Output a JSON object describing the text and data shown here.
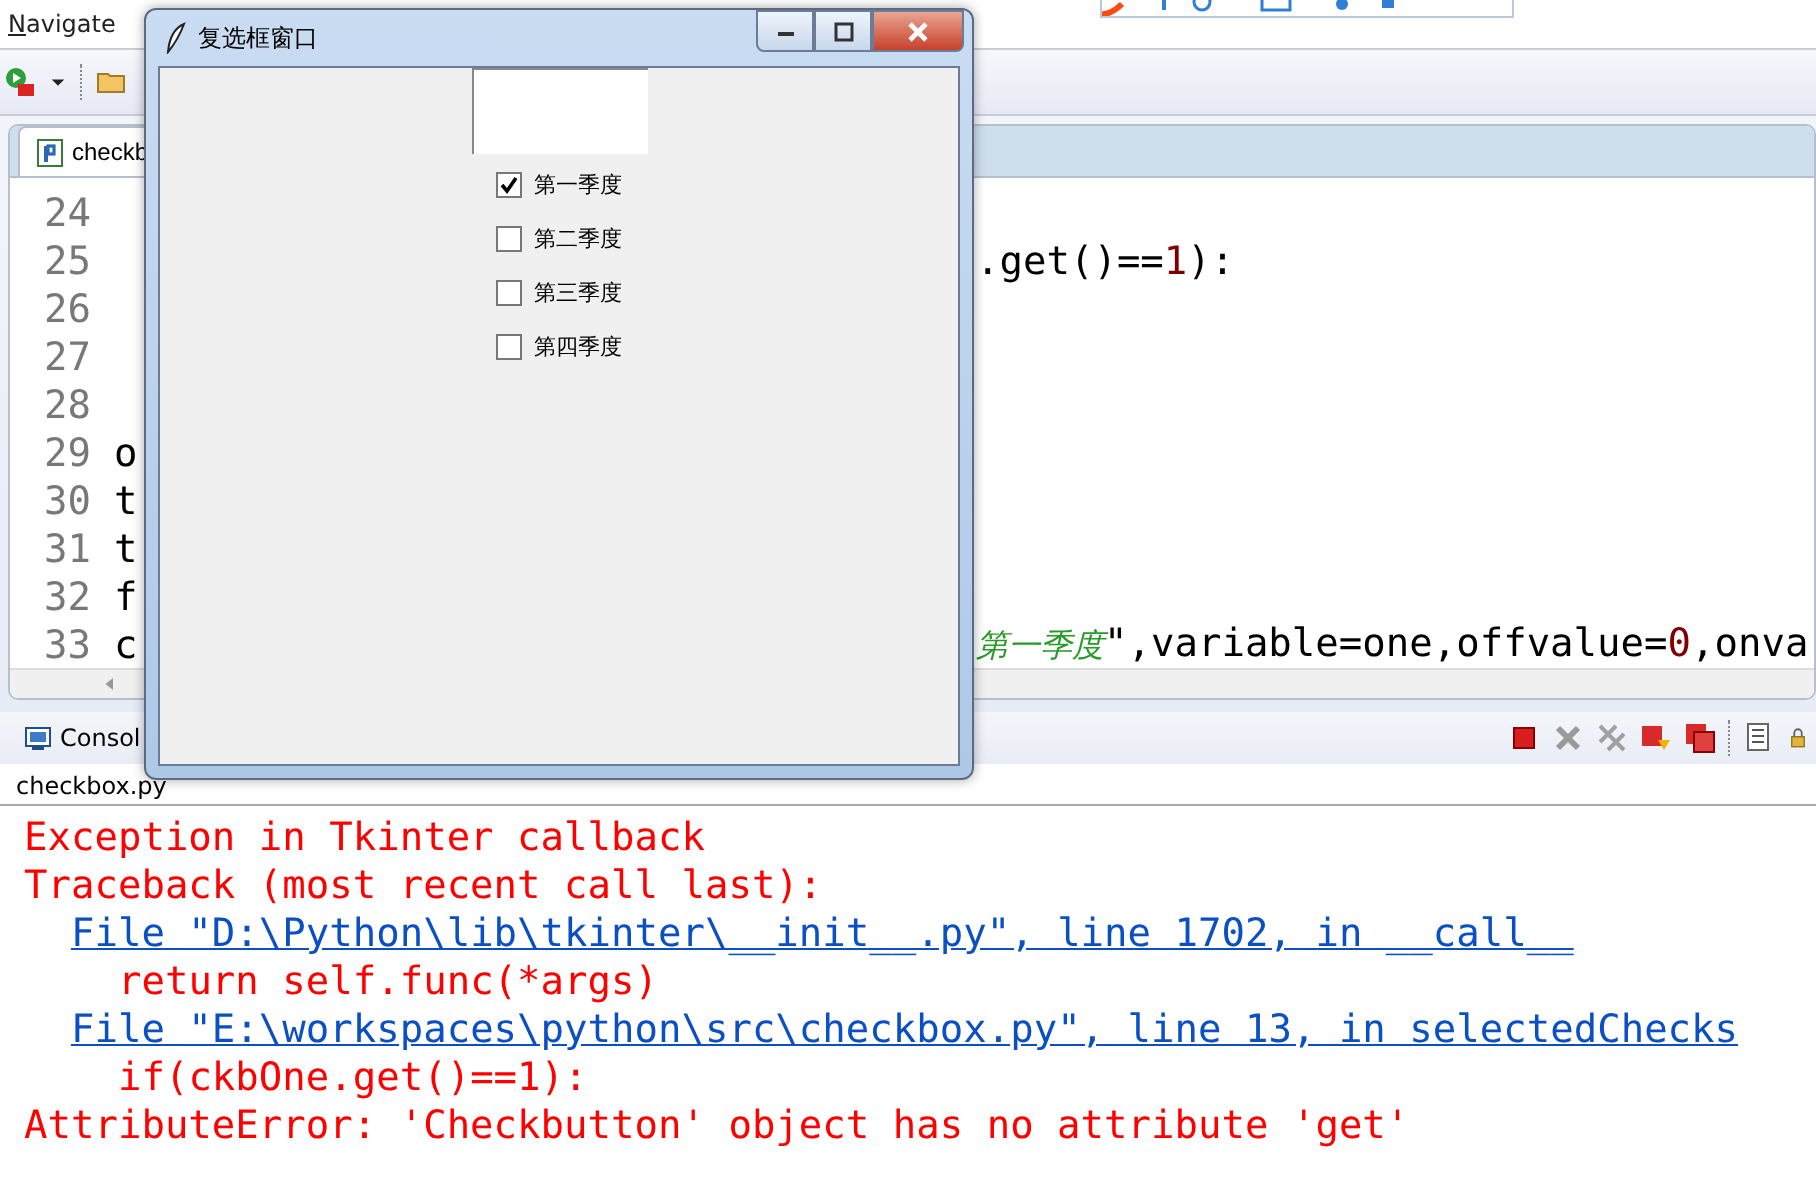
{
  "menu": [
    {
      "label": "Navigate"
    }
  ],
  "editor": {
    "tab": {
      "label": "checkb",
      "selected": true
    },
    "lines": [
      {
        "number": "24"
      },
      {
        "number": "25",
        "right": [
          {
            "text": ".get()==",
            "kind": "plain"
          },
          {
            "text": "1",
            "kind": "number"
          },
          {
            "text": "):",
            "kind": "plain"
          }
        ]
      },
      {
        "number": "26"
      },
      {
        "number": "27"
      },
      {
        "number": "28"
      },
      {
        "number": "29",
        "left": "o"
      },
      {
        "number": "30",
        "left": "t"
      },
      {
        "number": "31",
        "left": "t"
      },
      {
        "number": "32",
        "left": "f"
      },
      {
        "number": "33",
        "left": "c",
        "right": [
          {
            "text": "第一季度",
            "kind": "string"
          },
          {
            "text": "\",variable=one,offvalue=",
            "kind": "plain"
          },
          {
            "text": "0",
            "kind": "number"
          },
          {
            "text": ",onva",
            "kind": "plain"
          }
        ]
      }
    ]
  },
  "console": {
    "tab": {
      "label": "Consol",
      "selected": true
    },
    "process": "checkbox.py",
    "output": [
      {
        "text": "Exception in Tkinter callback",
        "kind": "error"
      },
      {
        "text": "Traceback (most recent call last):",
        "kind": "error"
      },
      {
        "text": "  File \"D:\\Python\\lib\\tkinter\\__init__.py\", line 1702, in __call__",
        "kind": "link"
      },
      {
        "text": "    return self.func(*args)",
        "kind": "error"
      },
      {
        "text": "  File \"E:\\workspaces\\python\\src\\checkbox.py\", line 13, in selectedChecks",
        "kind": "link"
      },
      {
        "text": "    if(ckbOne.get()==1):",
        "kind": "error"
      },
      {
        "text": "AttributeError: 'Checkbutton' object has no attribute 'get'",
        "kind": "error"
      }
    ]
  },
  "tk_window": {
    "title": "复选框窗口",
    "checkboxes": [
      {
        "label": "第一季度",
        "checked": true
      },
      {
        "label": "第二季度",
        "checked": false
      },
      {
        "label": "第三季度",
        "checked": false
      },
      {
        "label": "第四季度",
        "checked": false
      }
    ]
  }
}
